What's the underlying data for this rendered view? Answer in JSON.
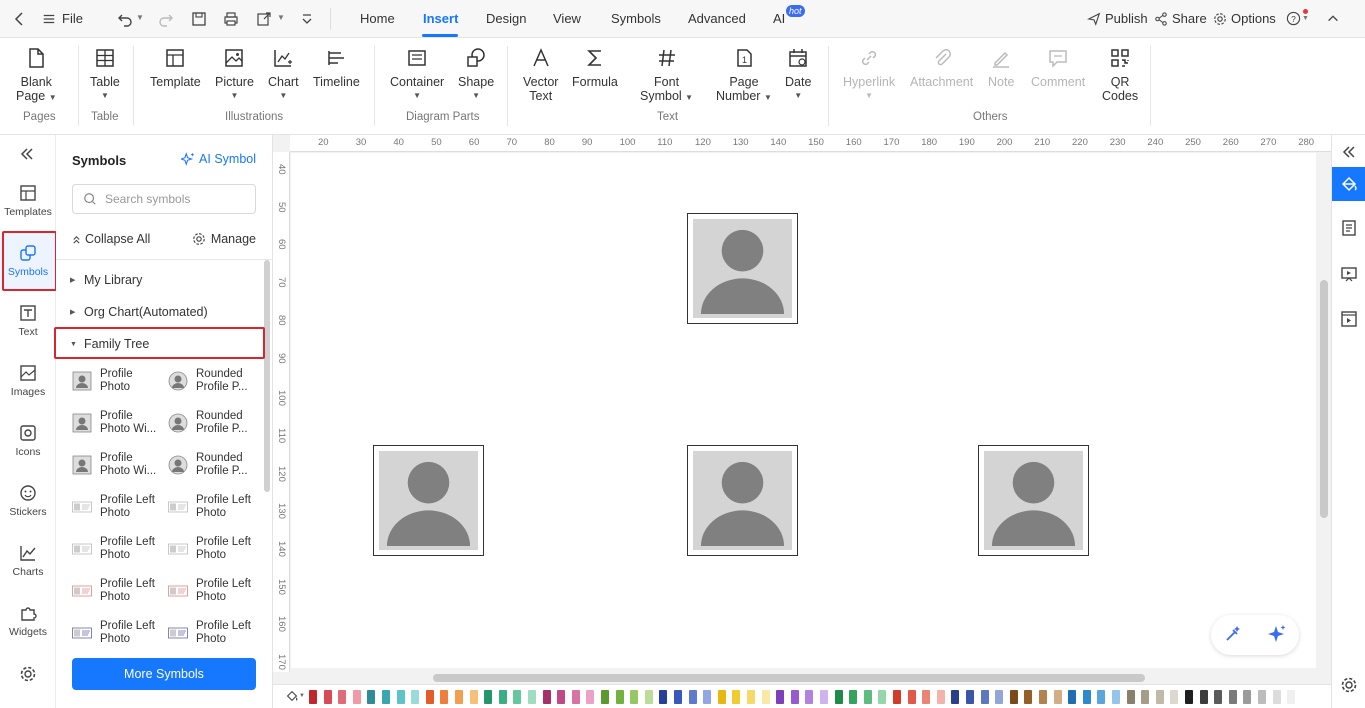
{
  "topbar": {
    "file_label": "File",
    "tabs": [
      {
        "label": "Home",
        "active": false
      },
      {
        "label": "Insert",
        "active": true
      },
      {
        "label": "Design",
        "active": false
      },
      {
        "label": "View",
        "active": false
      },
      {
        "label": "Symbols",
        "active": false
      },
      {
        "label": "Advanced",
        "active": false
      },
      {
        "label": "AI",
        "active": false
      }
    ],
    "ai_badge": "hot",
    "publish": "Publish",
    "share": "Share",
    "options": "Options"
  },
  "ribbon": {
    "buttons": {
      "blank_page": [
        "Blank",
        "Page"
      ],
      "table": "Table",
      "template": "Template",
      "picture": "Picture",
      "chart": "Chart",
      "timeline": "Timeline",
      "container": "Container",
      "shape": "Shape",
      "vector_text": [
        "Vector",
        "Text"
      ],
      "formula": "Formula",
      "font_symbol": [
        "Font",
        "Symbol"
      ],
      "page_number": [
        "Page",
        "Number"
      ],
      "date": "Date",
      "hyperlink": "Hyperlink",
      "attachment": "Attachment",
      "note": "Note",
      "comment": "Comment",
      "qr_codes": [
        "QR",
        "Codes"
      ]
    },
    "groups": {
      "pages": "Pages",
      "table": "Table",
      "illustrations": "Illustrations",
      "diagram_parts": "Diagram Parts",
      "text": "Text",
      "others": "Others"
    }
  },
  "rail": {
    "items": [
      {
        "label": "Templates"
      },
      {
        "label": "Symbols"
      },
      {
        "label": "Text"
      },
      {
        "label": "Images"
      },
      {
        "label": "Icons"
      },
      {
        "label": "Stickers"
      },
      {
        "label": "Charts"
      },
      {
        "label": "Widgets"
      }
    ]
  },
  "panel": {
    "title": "Symbols",
    "ai_symbol": "AI Symbol",
    "search_placeholder": "Search symbols",
    "collapse_all": "Collapse All",
    "manage": "Manage",
    "categories": [
      {
        "label": "My Library",
        "expanded": false
      },
      {
        "label": "Org Chart(Automated)",
        "expanded": false
      },
      {
        "label": "Family Tree",
        "expanded": true
      }
    ],
    "symbols": [
      [
        "Profile",
        "Photo"
      ],
      [
        "Rounded",
        "Profile P..."
      ],
      [
        "Profile",
        "Photo Wi..."
      ],
      [
        "Rounded",
        "Profile P..."
      ],
      [
        "Profile",
        "Photo Wi..."
      ],
      [
        "Rounded",
        "Profile P..."
      ],
      [
        "Profile Left",
        "Photo"
      ],
      [
        "Profile Left",
        "Photo"
      ],
      [
        "Profile Left",
        "Photo"
      ],
      [
        "Profile Left",
        "Photo"
      ],
      [
        "Profile Left",
        "Photo"
      ],
      [
        "Profile Left",
        "Photo"
      ],
      [
        "Profile Left",
        "Photo"
      ],
      [
        "Profile Left",
        "Photo"
      ]
    ],
    "more_symbols": "More Symbols"
  },
  "ruler": {
    "top": [
      "20",
      "30",
      "40",
      "50",
      "60",
      "70",
      "80",
      "90",
      "100",
      "110",
      "120",
      "130",
      "140",
      "150",
      "160",
      "170",
      "180",
      "190",
      "200",
      "210",
      "220",
      "230",
      "240",
      "250",
      "260",
      "270",
      "280"
    ],
    "left": [
      "40",
      "50",
      "60",
      "70",
      "80",
      "90",
      "100",
      "110",
      "120",
      "130",
      "140",
      "150",
      "160",
      "170"
    ]
  },
  "palette": [
    "#c0282e",
    "#d94a5a",
    "#e26b7a",
    "#ef9aa5",
    "#2f8b96",
    "#3aa7b0",
    "#5cc3c8",
    "#9adbd9",
    "#e35d2c",
    "#ee7e3c",
    "#f2a04e",
    "#f6c078",
    "#23966e",
    "#3aaf85",
    "#66c6a0",
    "#9fdcc2",
    "#a6306a",
    "#c04a86",
    "#d774a4",
    "#eaa3c4",
    "#5b9a2e",
    "#74b23f",
    "#97c763",
    "#bddc97",
    "#263f9a",
    "#3a58bb",
    "#5d79d0",
    "#91a6e2",
    "#e6b810",
    "#f1cb2f",
    "#f5da68",
    "#f9e9a5",
    "#7e3fb8",
    "#975ad0",
    "#b283de",
    "#d0b2ec",
    "#1f8a4a",
    "#33a35e",
    "#5dbd80",
    "#96d6ab",
    "#d23a2a",
    "#e2594a",
    "#ec8476",
    "#f4b3aa",
    "#2a3f8a",
    "#3b56a8",
    "#5d78c3",
    "#93a6dc",
    "#7a4a1c",
    "#955f2a",
    "#b4824e",
    "#d2ad86",
    "#1f6fb0",
    "#2f88cc",
    "#5aa5dc",
    "#94c6ea",
    "#8a7f6a",
    "#a69c88",
    "#c2baa9",
    "#ddd7cc",
    "#1f1f1f",
    "#3c3c3c",
    "#5a5a5a",
    "#7a7a7a",
    "#9b9b9b",
    "#bcbcbc",
    "#dcdcdc",
    "#f0f0f0"
  ]
}
